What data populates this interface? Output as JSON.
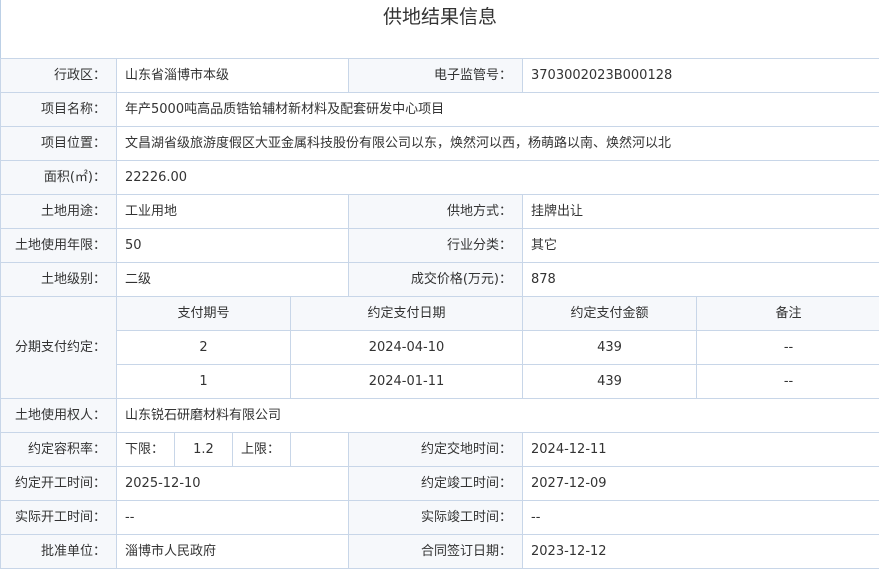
{
  "page": {
    "title": "供地结果信息"
  },
  "fields": {
    "district_label": "行政区：",
    "district": "山东省淄博市本级",
    "supervision_no_label": "电子监管号：",
    "supervision_no": "3703002023B000128",
    "project_name_label": "项目名称：",
    "project_name": "年产5000吨高品质锆铪辅材新材料及配套研发中心项目",
    "location_label": "项目位置：",
    "location": "文昌湖省级旅游度假区大亚金属科技股份有限公司以东，焕然河以西，杨萌路以南、焕然河以北",
    "area_label": "面积(㎡)：",
    "area": "22226.00",
    "land_use_label": "土地用途：",
    "land_use": "工业用地",
    "supply_method_label": "供地方式：",
    "supply_method": "挂牌出让",
    "use_years_label": "土地使用年限：",
    "use_years": "50",
    "industry_label": "行业分类：",
    "industry": "其它",
    "land_grade_label": "土地级别：",
    "land_grade": "二级",
    "price_label": "成交价格(万元)：",
    "price": "878",
    "installment_label": "分期支付约定：",
    "owner_label": "土地使用权人：",
    "owner": "山东锐石研磨材料有限公司",
    "far_label": "约定容积率：",
    "far_lower_label": "下限：",
    "far_lower": "1.2",
    "far_upper_label": "上限：",
    "far_upper": "",
    "handover_label": "约定交地时间：",
    "handover": "2024-12-11",
    "start_label": "约定开工时间：",
    "start": "2025-12-10",
    "complete_label": "约定竣工时间：",
    "complete": "2027-12-09",
    "actual_start_label": "实际开工时间：",
    "actual_start": "--",
    "actual_complete_label": "实际竣工时间：",
    "actual_complete": "--",
    "approver_label": "批准单位：",
    "approver": "淄博市人民政府",
    "contract_date_label": "合同签订日期：",
    "contract_date": "2023-12-12"
  },
  "installments": {
    "headers": [
      "支付期号",
      "约定支付日期",
      "约定支付金额",
      "备注"
    ],
    "rows": [
      [
        "2",
        "2024-04-10",
        "439",
        "--"
      ],
      [
        "1",
        "2024-01-11",
        "439",
        "--"
      ]
    ]
  }
}
